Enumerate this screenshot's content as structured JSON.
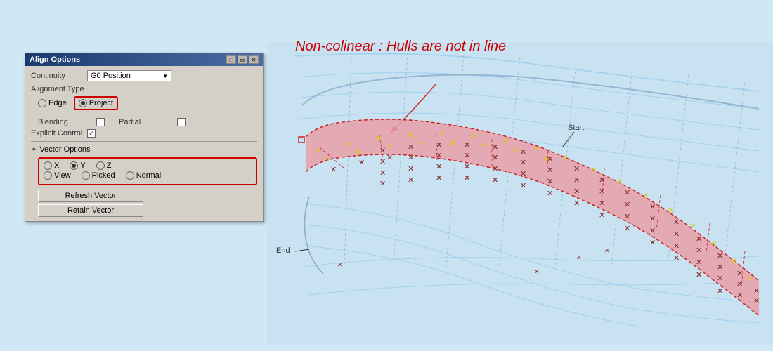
{
  "dialog": {
    "title": "Align Options",
    "titlebar_buttons": [
      "□",
      "▭",
      "✕"
    ],
    "continuity": {
      "label": "Continuity",
      "value": "G0 Position"
    },
    "alignment_type": {
      "label": "Alignment Type",
      "options": [
        {
          "id": "edge",
          "label": "Edge",
          "selected": false
        },
        {
          "id": "project",
          "label": "Project",
          "selected": true
        }
      ]
    },
    "blending": {
      "label": "Blending",
      "checked": false
    },
    "partial": {
      "label": "Partial",
      "checked": false
    },
    "explicit_control": {
      "label": "Explicit Control",
      "checked": true
    },
    "vector_options": {
      "section_label": "Vector Options",
      "axis_options": [
        {
          "id": "x",
          "label": "X",
          "selected": false
        },
        {
          "id": "y",
          "label": "Y",
          "selected": true
        },
        {
          "id": "z",
          "label": "Z",
          "selected": false
        }
      ],
      "dir_options": [
        {
          "id": "view",
          "label": "View",
          "selected": false
        },
        {
          "id": "picked",
          "label": "Picked",
          "selected": false
        },
        {
          "id": "normal",
          "label": "Normal",
          "selected": false
        }
      ],
      "refresh_label": "Refresh Vector",
      "retain_label": "Retain Vector"
    }
  },
  "annotation": {
    "text": "Non-colinear : Hulls are not in line"
  },
  "canvas_labels": {
    "start": "Start",
    "end": "End"
  },
  "colors": {
    "highlight_red": "#cc0000",
    "blue_surface": "#a8d0e8",
    "pink_surface": "#e8a0a0",
    "yellow_cross": "#dddd00",
    "dark_red_cross": "#880000"
  }
}
